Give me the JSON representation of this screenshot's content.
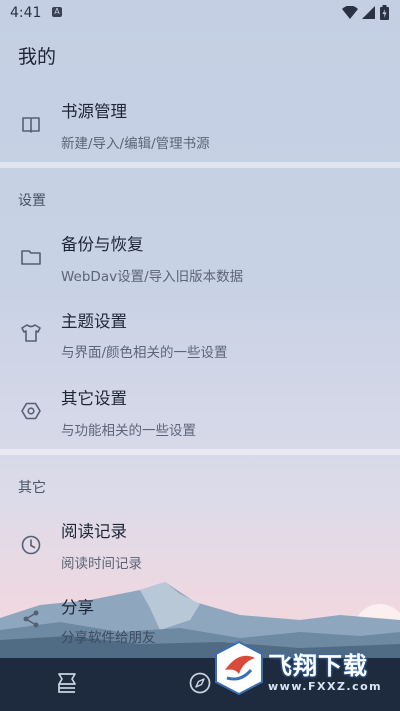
{
  "status_bar": {
    "time": "4:41",
    "notif_badge": "A"
  },
  "app_bar": {
    "title": "我的"
  },
  "book_source": {
    "icon": "book-icon",
    "title": "书源管理",
    "subtitle": "新建/导入/编辑/管理书源"
  },
  "settings": {
    "header": "设置",
    "items": [
      {
        "icon": "folder-icon",
        "title": "备份与恢复",
        "subtitle": "WebDav设置/导入旧版本数据"
      },
      {
        "icon": "tshirt-icon",
        "title": "主题设置",
        "subtitle": "与界面/颜色相关的一些设置"
      },
      {
        "icon": "hexagon-settings-icon",
        "title": "其它设置",
        "subtitle": "与功能相关的一些设置"
      }
    ]
  },
  "other": {
    "header": "其它",
    "items": [
      {
        "icon": "clock-icon",
        "title": "阅读记录",
        "subtitle": "阅读时间记录"
      },
      {
        "icon": "share-icon",
        "title": "分享",
        "subtitle": "分享软件给朋友"
      }
    ]
  },
  "bottom_nav": {
    "items": [
      "bookshelf-icon",
      "compass-icon"
    ]
  },
  "watermark": {
    "text": "飞翔下载",
    "url": "www.FXXZ.com"
  },
  "colors": {
    "bottom_nav_bg": "#1e2a3d",
    "text_primary": "#1e2636",
    "text_secondary": "#5c6577"
  }
}
